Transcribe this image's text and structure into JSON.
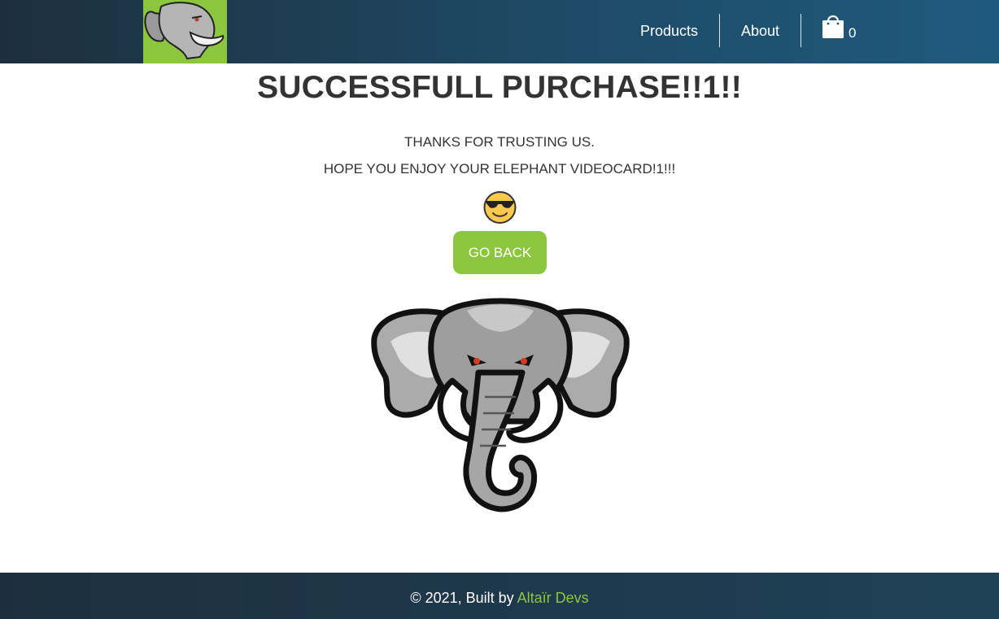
{
  "header": {
    "logo_icon": "elephant-logo-icon",
    "nav": [
      {
        "label": "Products"
      },
      {
        "label": "About"
      }
    ],
    "cart": {
      "icon": "shopping-bag-icon",
      "count": "0"
    }
  },
  "main": {
    "title": "SUCCESSFULL PURCHASE!!1!!",
    "message_line_1": "THANKS FOR TRUSTING US.",
    "message_line_2": "HOPE YOU ENJOY YOUR ELEPHANT VIDEOCARD!1!!!",
    "emoji_icon": "sunglasses-smiley-icon",
    "go_back_label": "GO BACK",
    "mascot_icon": "elephant-mascot-icon"
  },
  "footer": {
    "prefix": "© 2021, Built by",
    "link_text": "Altaïr Devs"
  },
  "colors": {
    "accent": "#8cc63f",
    "header_dark": "#1d2f3d",
    "header_light": "#1f5a7d",
    "text": "#333333"
  }
}
